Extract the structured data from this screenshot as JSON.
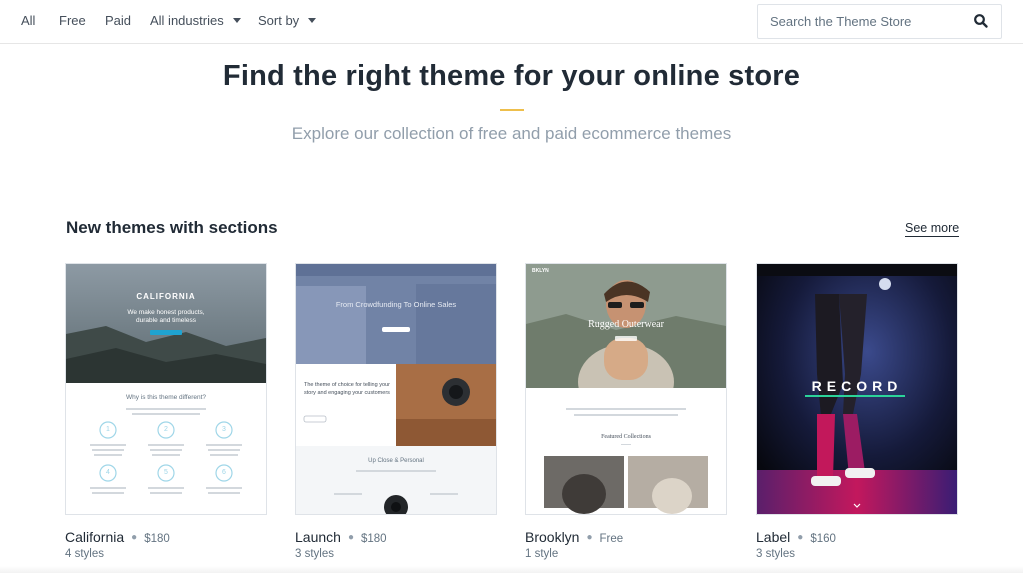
{
  "filters": {
    "all": "All",
    "free": "Free",
    "paid": "Paid",
    "industries": "All industries",
    "sort": "Sort by"
  },
  "search": {
    "placeholder": "Search the Theme Store"
  },
  "hero": {
    "title": "Find the right theme for your online store",
    "subtitle": "Explore our collection of free and paid ecommerce themes"
  },
  "section": {
    "title": "New themes with sections",
    "see_more": "See more"
  },
  "themes": [
    {
      "name": "California",
      "price": "$180",
      "styles": "4 styles",
      "preview": {
        "brand": "CALIFORNIA",
        "tagline_1": "We make honest products,",
        "tagline_2": "durable and timeless",
        "heading": "Why is this theme different?",
        "steps": [
          "1",
          "2",
          "3",
          "4",
          "5",
          "6"
        ]
      }
    },
    {
      "name": "Launch",
      "price": "$180",
      "styles": "3 styles",
      "preview": {
        "headline": "From Crowdfunding To Online Sales",
        "blurb_1": "The theme of choice for telling your",
        "blurb_2": "story and engaging your customers",
        "heading": "Up Close & Personal"
      }
    },
    {
      "name": "Brooklyn",
      "price": "Free",
      "styles": "1 style",
      "preview": {
        "brand": "BKLYN",
        "headline": "Rugged Outerwear",
        "heading": "Featured Collections"
      }
    },
    {
      "name": "Label",
      "price": "$160",
      "styles": "3 styles",
      "preview": {
        "brand": "RECORD"
      }
    }
  ],
  "colors": {
    "accent": "#eebf4c",
    "text": "#212b36",
    "muted": "#919eab"
  }
}
